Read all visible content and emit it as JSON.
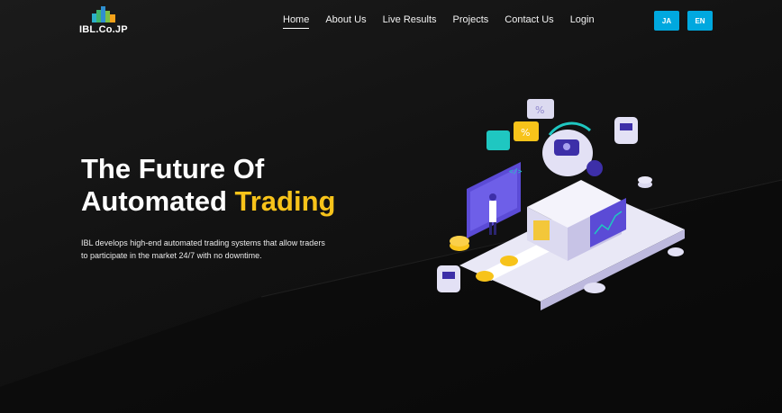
{
  "brand": {
    "logo_text": "IBL.Co.JP"
  },
  "nav": {
    "items": [
      {
        "label": "Home",
        "active": true
      },
      {
        "label": "About Us"
      },
      {
        "label": "Live Results"
      },
      {
        "label": "Projects"
      },
      {
        "label": "Contact Us"
      },
      {
        "label": "Login"
      }
    ]
  },
  "lang": {
    "ja": "JA",
    "en": "EN"
  },
  "hero": {
    "title_line1": "The Future Of",
    "title_line2_prefix": "Automated",
    "title_line2_highlight": "Trading",
    "description": "IBL develops high-end automated trading systems that allow traders to participate in the market 24/7 with no downtime."
  },
  "colors": {
    "accent": "#00a8df",
    "highlight": "#f7c31a",
    "background": "#0d0d0d",
    "illustration_purple": "#5b4bd6"
  },
  "illustration": {
    "icon": "automated-trading-illustration"
  }
}
